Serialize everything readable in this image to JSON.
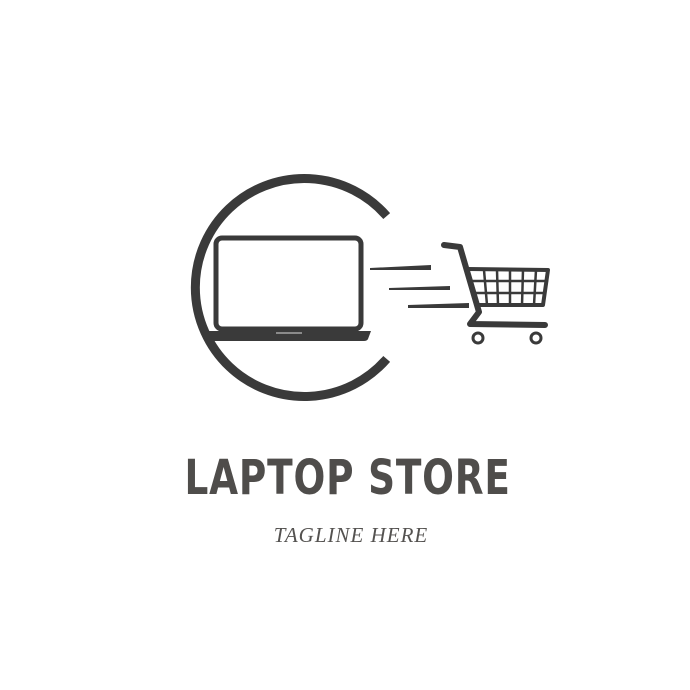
{
  "logo": {
    "brand_name": "LAPTOP STORE",
    "tagline": "TAGLINE HERE",
    "icons": [
      "circle-ring",
      "laptop-icon",
      "speed-lines-icon",
      "shopping-cart-icon"
    ],
    "colors": {
      "ink": "#3a3a3a",
      "brand_text": "#4f4d4b",
      "tagline_text": "#545250",
      "background": "#ffffff"
    }
  }
}
